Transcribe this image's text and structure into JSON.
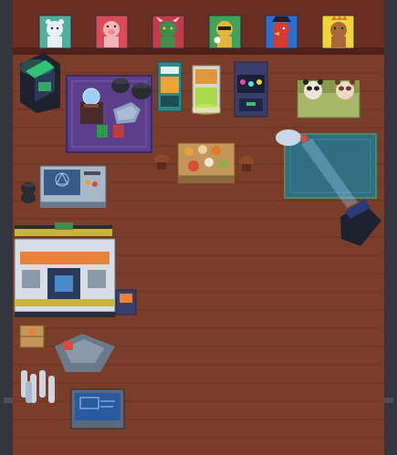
{
  "scene": {
    "title": "",
    "colors": {
      "wall_dark": "#2b2d38",
      "wall_top": "#4a4f5c",
      "wood_floor": "#7a3d2a",
      "wood_plank_line": "#6a3222",
      "baseboard": "#5c2b1e",
      "rug_purple": "#5b3f8c",
      "rug_teal": "#2f6f80",
      "accent_green": "#3fbf6a",
      "accent_yellow": "#e8c23a"
    }
  },
  "posters": [
    {
      "character": "white-bear",
      "bg": "#4fb0a0",
      "body": "#e9eef2"
    },
    {
      "character": "pink-pig",
      "bg": "#d84c5a",
      "body": "#f2b5b5"
    },
    {
      "character": "green-goblin",
      "bg": "#c23b4a",
      "body": "#3f8f4a"
    },
    {
      "character": "yellow-dog-sunglasses",
      "bg": "#3fa35a",
      "body": "#e8b43a"
    },
    {
      "character": "red-bird-pirate",
      "bg": "#2d6fd1",
      "body": "#d93a2f"
    },
    {
      "character": "brown-bear-crown",
      "bg": "#f0d53a",
      "body": "#a8683a"
    }
  ],
  "furniture": {
    "arcade": "arcade-cabinet",
    "crystal_table": "crystal-ball-table",
    "cauldrons": "cauldrons",
    "vending_a": "snack-vending-machine",
    "vending_b": "drink-cooler",
    "vending_c": "neon-vending-machine",
    "sofa": "panda-plush-sofa",
    "dining": "food-table",
    "blue_rug": "teal-rug",
    "projector": "projector",
    "alchemy": "alchemy-bench",
    "cauldron_small": "small-cauldron",
    "lab": "laboratory-chamber",
    "crate": "supply-crate",
    "anvil": "workbench-anvil",
    "gas_cylinders": "gas-cylinders",
    "blueprint": "blueprint-table",
    "backpack": "player-backpack"
  }
}
